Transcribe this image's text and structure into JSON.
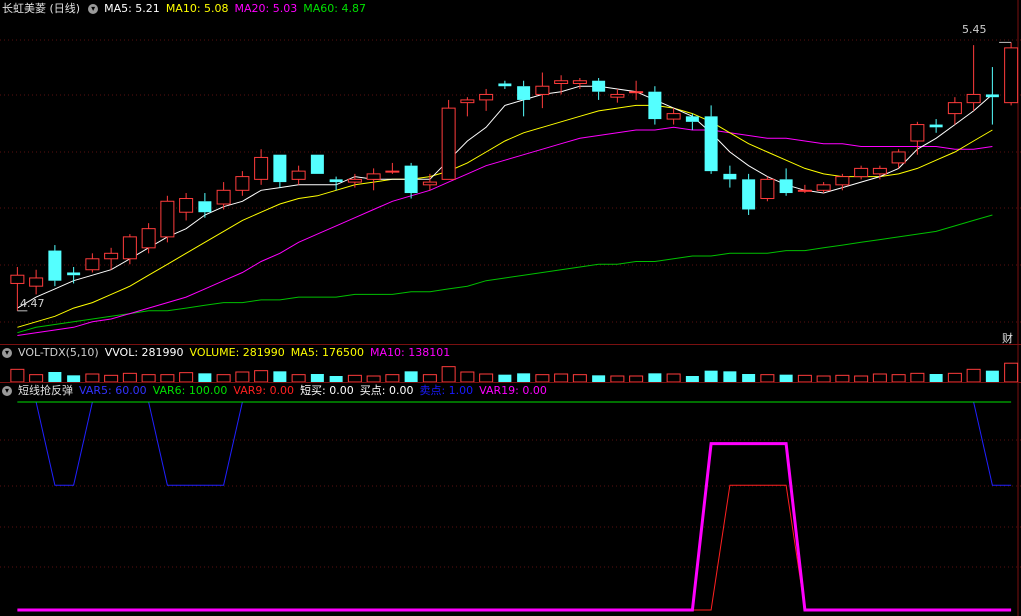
{
  "panel1": {
    "title": "长虹美菱 (日线)",
    "ma_labels": [
      {
        "text": "MA5: 5.21",
        "color": "#ffffff"
      },
      {
        "text": "MA10: 5.08",
        "color": "#ffff00"
      },
      {
        "text": "MA20: 5.03",
        "color": "#ff00ff"
      },
      {
        "text": "MA60: 4.87",
        "color": "#00e000"
      }
    ],
    "high_label": "5.45",
    "low_label": "4.47",
    "right_badge": "财"
  },
  "panel2": {
    "title": "VOL-TDX(5,10)",
    "labels": [
      {
        "text": "VVOL: 281990",
        "color": "#ffffff"
      },
      {
        "text": "VOLUME: 281990",
        "color": "#ffff00"
      },
      {
        "text": "MA5: 176500",
        "color": "#ffff00"
      },
      {
        "text": "MA10: 138101",
        "color": "#ff00ff"
      }
    ]
  },
  "panel3": {
    "title": "短线抢反弹",
    "labels": [
      {
        "text": "VAR5: 60.00",
        "color": "#3232ff"
      },
      {
        "text": "VAR6: 100.00",
        "color": "#00e000"
      },
      {
        "text": "VAR9: 0.00",
        "color": "#ff2020"
      },
      {
        "text": "短买: 0.00",
        "color": "#ffffff"
      },
      {
        "text": "买点: 0.00",
        "color": "#ffffff"
      },
      {
        "text": "卖点: 1.00",
        "color": "#1a1aff"
      },
      {
        "text": "VAR19: 0.00",
        "color": "#ff00ff"
      }
    ]
  },
  "chart_data": [
    {
      "type": "candlestick",
      "title": "长虹美菱 (日线)",
      "y_range": [
        4.4,
        5.55
      ],
      "annotations": {
        "high": 5.45,
        "low": 4.47
      },
      "candles_ohlc": [
        [
          4.57,
          4.63,
          4.47,
          4.6
        ],
        [
          4.56,
          4.62,
          4.53,
          4.59
        ],
        [
          4.69,
          4.71,
          4.56,
          4.58
        ],
        [
          4.61,
          4.63,
          4.57,
          4.6
        ],
        [
          4.62,
          4.68,
          4.61,
          4.66
        ],
        [
          4.66,
          4.7,
          4.62,
          4.68
        ],
        [
          4.66,
          4.75,
          4.64,
          4.74
        ],
        [
          4.7,
          4.79,
          4.68,
          4.77
        ],
        [
          4.74,
          4.89,
          4.72,
          4.87
        ],
        [
          4.83,
          4.9,
          4.8,
          4.88
        ],
        [
          4.87,
          4.9,
          4.81,
          4.83
        ],
        [
          4.86,
          4.94,
          4.84,
          4.91
        ],
        [
          4.91,
          4.98,
          4.89,
          4.96
        ],
        [
          4.95,
          5.06,
          4.93,
          5.03
        ],
        [
          5.04,
          5.04,
          4.92,
          4.94
        ],
        [
          4.95,
          5.0,
          4.93,
          4.98
        ],
        [
          5.04,
          5.04,
          4.97,
          4.97
        ],
        [
          4.95,
          4.96,
          4.91,
          4.94
        ],
        [
          4.94,
          4.97,
          4.92,
          4.95
        ],
        [
          4.95,
          4.99,
          4.91,
          4.97
        ],
        [
          4.98,
          5.01,
          4.97,
          4.98
        ],
        [
          5.0,
          5.01,
          4.88,
          4.9
        ],
        [
          4.93,
          4.97,
          4.91,
          4.94
        ],
        [
          4.95,
          5.24,
          4.95,
          5.21
        ],
        [
          5.23,
          5.25,
          5.18,
          5.24
        ],
        [
          5.24,
          5.28,
          5.2,
          5.26
        ],
        [
          5.3,
          5.31,
          5.28,
          5.29
        ],
        [
          5.29,
          5.31,
          5.18,
          5.24
        ],
        [
          5.26,
          5.34,
          5.21,
          5.29
        ],
        [
          5.3,
          5.33,
          5.26,
          5.31
        ],
        [
          5.3,
          5.32,
          5.28,
          5.31
        ],
        [
          5.31,
          5.32,
          5.24,
          5.27
        ],
        [
          5.25,
          5.28,
          5.23,
          5.26
        ],
        [
          5.27,
          5.31,
          5.24,
          5.27
        ],
        [
          5.27,
          5.29,
          5.15,
          5.17
        ],
        [
          5.17,
          5.21,
          5.15,
          5.19
        ],
        [
          5.18,
          5.19,
          5.13,
          5.16
        ],
        [
          5.18,
          5.22,
          4.97,
          4.98
        ],
        [
          4.97,
          5.0,
          4.92,
          4.95
        ],
        [
          4.95,
          4.97,
          4.82,
          4.84
        ],
        [
          4.88,
          4.96,
          4.87,
          4.95
        ],
        [
          4.95,
          4.99,
          4.89,
          4.9
        ],
        [
          4.91,
          4.93,
          4.9,
          4.91
        ],
        [
          4.91,
          4.94,
          4.9,
          4.93
        ],
        [
          4.93,
          4.97,
          4.91,
          4.96
        ],
        [
          4.96,
          5.0,
          4.95,
          4.99
        ],
        [
          4.97,
          5.0,
          4.95,
          4.99
        ],
        [
          5.01,
          5.06,
          4.99,
          5.05
        ],
        [
          5.09,
          5.16,
          5.04,
          5.15
        ],
        [
          5.15,
          5.17,
          5.12,
          5.14
        ],
        [
          5.19,
          5.25,
          5.15,
          5.23
        ],
        [
          5.23,
          5.44,
          5.2,
          5.26
        ],
        [
          5.26,
          5.36,
          5.15,
          5.25
        ],
        [
          5.23,
          5.45,
          5.22,
          5.43
        ]
      ],
      "MA5_points": [
        4.48,
        4.52,
        4.55,
        4.58,
        4.6,
        4.62,
        4.66,
        4.7,
        4.74,
        4.77,
        4.82,
        4.85,
        4.87,
        4.91,
        4.92,
        4.93,
        4.93,
        4.93,
        4.96,
        4.95,
        4.95,
        4.95,
        4.95,
        5.02,
        5.09,
        5.14,
        5.22,
        5.24,
        5.26,
        5.27,
        5.29,
        5.29,
        5.28,
        5.27,
        5.24,
        5.21,
        5.18,
        5.12,
        5.05,
        5.0,
        4.96,
        4.93,
        4.91,
        4.9,
        4.92,
        4.94,
        4.96,
        4.99,
        5.06,
        5.1,
        5.15,
        5.2,
        5.26
      ],
      "MA10_points": [
        4.41,
        4.43,
        4.45,
        4.48,
        4.5,
        4.53,
        4.56,
        4.6,
        4.64,
        4.68,
        4.72,
        4.76,
        4.8,
        4.83,
        4.86,
        4.88,
        4.89,
        4.91,
        4.93,
        4.94,
        4.95,
        4.95,
        4.96,
        4.98,
        5.01,
        5.05,
        5.09,
        5.12,
        5.14,
        5.16,
        5.18,
        5.2,
        5.21,
        5.22,
        5.22,
        5.21,
        5.19,
        5.16,
        5.12,
        5.08,
        5.05,
        5.02,
        4.99,
        4.97,
        4.96,
        4.96,
        4.96,
        4.97,
        4.99,
        5.02,
        5.05,
        5.09,
        5.13
      ],
      "MA20_points": [
        4.38,
        4.39,
        4.4,
        4.41,
        4.43,
        4.44,
        4.46,
        4.48,
        4.5,
        4.52,
        4.55,
        4.58,
        4.61,
        4.65,
        4.68,
        4.72,
        4.75,
        4.78,
        4.81,
        4.84,
        4.87,
        4.89,
        4.91,
        4.94,
        4.97,
        5.0,
        5.02,
        5.04,
        5.06,
        5.08,
        5.1,
        5.11,
        5.12,
        5.13,
        5.13,
        5.14,
        5.13,
        5.13,
        5.12,
        5.11,
        5.1,
        5.1,
        5.09,
        5.08,
        5.08,
        5.07,
        5.07,
        5.07,
        5.07,
        5.07,
        5.06,
        5.06,
        5.07
      ],
      "MA60_points": [
        4.39,
        4.41,
        4.42,
        4.43,
        4.44,
        4.45,
        4.46,
        4.47,
        4.47,
        4.48,
        4.49,
        4.5,
        4.5,
        4.51,
        4.51,
        4.52,
        4.52,
        4.52,
        4.53,
        4.53,
        4.53,
        4.54,
        4.54,
        4.55,
        4.56,
        4.58,
        4.59,
        4.6,
        4.61,
        4.62,
        4.63,
        4.64,
        4.64,
        4.65,
        4.65,
        4.66,
        4.67,
        4.67,
        4.68,
        4.68,
        4.68,
        4.69,
        4.69,
        4.7,
        4.71,
        4.72,
        4.73,
        4.74,
        4.75,
        4.76,
        4.78,
        4.8,
        4.82
      ]
    },
    {
      "type": "bar",
      "title": "VOL-TDX(5,10)",
      "y_range": [
        0,
        300000
      ],
      "volumes": [
        190000,
        110000,
        150000,
        100000,
        120000,
        100000,
        130000,
        110000,
        110000,
        140000,
        130000,
        110000,
        150000,
        170000,
        160000,
        110000,
        120000,
        90000,
        100000,
        90000,
        110000,
        160000,
        110000,
        230000,
        150000,
        120000,
        110000,
        130000,
        110000,
        120000,
        110000,
        100000,
        90000,
        90000,
        130000,
        120000,
        90000,
        170000,
        160000,
        120000,
        110000,
        110000,
        100000,
        90000,
        100000,
        90000,
        120000,
        110000,
        130000,
        120000,
        130000,
        190000,
        170000,
        281990
      ]
    },
    {
      "type": "line",
      "title": "短线抢反弹",
      "y_range": [
        0,
        100
      ],
      "series": [
        {
          "name": "VAR5",
          "color": "#2020ff",
          "values": [
            100,
            100,
            60,
            60,
            100,
            100,
            100,
            100,
            60,
            60,
            60,
            60,
            100,
            100,
            100,
            100,
            100,
            100,
            100,
            100,
            100,
            100,
            100,
            100,
            100,
            100,
            100,
            100,
            100,
            100,
            100,
            100,
            100,
            100,
            100,
            100,
            100,
            100,
            100,
            100,
            100,
            100,
            100,
            100,
            100,
            100,
            100,
            100,
            100,
            100,
            100,
            100,
            60,
            60
          ]
        },
        {
          "name": "VAR6",
          "color": "#00e000",
          "values": [
            100,
            100,
            100,
            100,
            100,
            100,
            100,
            100,
            100,
            100,
            100,
            100,
            100,
            100,
            100,
            100,
            100,
            100,
            100,
            100,
            100,
            100,
            100,
            100,
            100,
            100,
            100,
            100,
            100,
            100,
            100,
            100,
            100,
            100,
            100,
            100,
            100,
            100,
            100,
            100,
            100,
            100,
            100,
            100,
            100,
            100,
            100,
            100,
            100,
            100,
            100,
            100,
            100,
            100
          ]
        },
        {
          "name": "VAR9",
          "color": "#ff2020",
          "values": [
            0,
            0,
            0,
            0,
            0,
            0,
            0,
            0,
            0,
            0,
            0,
            0,
            0,
            0,
            0,
            0,
            0,
            0,
            0,
            0,
            0,
            0,
            0,
            0,
            0,
            0,
            0,
            0,
            0,
            0,
            0,
            0,
            0,
            0,
            0,
            0,
            0,
            0,
            60,
            60,
            60,
            60,
            0,
            0,
            0,
            0,
            0,
            0,
            0,
            0,
            0,
            0,
            0,
            0
          ]
        },
        {
          "name": "VAR19",
          "color": "#ff00ff",
          "values": [
            0,
            0,
            0,
            0,
            0,
            0,
            0,
            0,
            0,
            0,
            0,
            0,
            0,
            0,
            0,
            0,
            0,
            0,
            0,
            0,
            0,
            0,
            0,
            0,
            0,
            0,
            0,
            0,
            0,
            0,
            0,
            0,
            0,
            0,
            0,
            0,
            0,
            80,
            80,
            80,
            80,
            80,
            0,
            0,
            0,
            0,
            0,
            0,
            0,
            0,
            0,
            0,
            0,
            0
          ]
        }
      ]
    }
  ]
}
